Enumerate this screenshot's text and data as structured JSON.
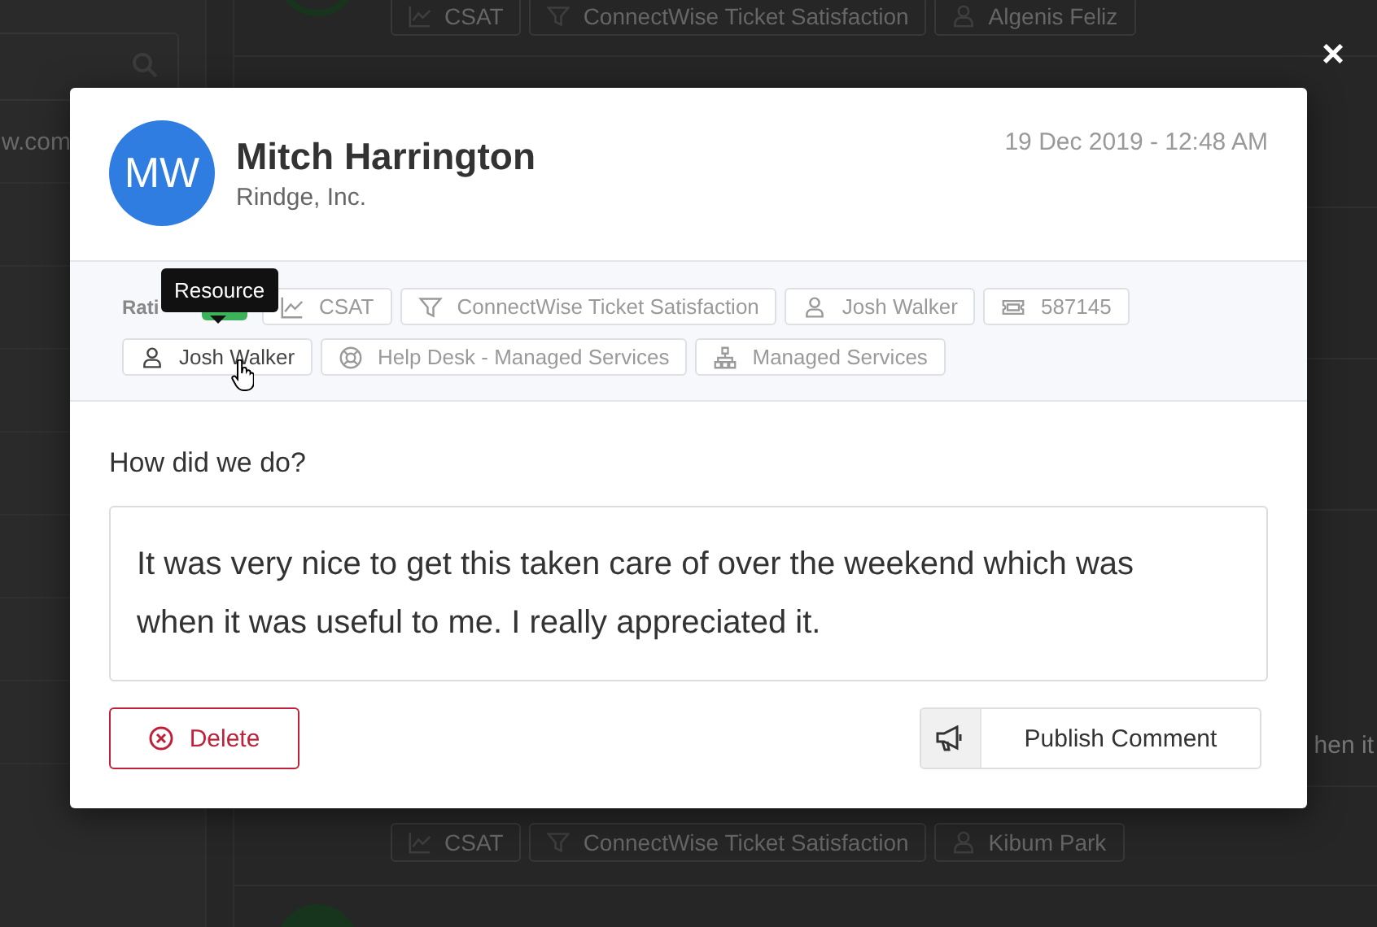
{
  "background": {
    "left_text": "w.com",
    "right_text": "hen it",
    "top_tags": [
      {
        "kind": "chart",
        "label": "CSAT"
      },
      {
        "kind": "filter",
        "label": "ConnectWise Ticket Satisfaction"
      },
      {
        "kind": "person",
        "label": "Algenis Feliz"
      }
    ],
    "bottom_tags": [
      {
        "kind": "chart",
        "label": "CSAT"
      },
      {
        "kind": "filter",
        "label": "ConnectWise Ticket Satisfaction"
      },
      {
        "kind": "person",
        "label": "Kibum Park"
      }
    ]
  },
  "dialog": {
    "close": "×",
    "avatar": "MW",
    "name": "Mitch Harrington",
    "company": "Rindge, Inc.",
    "date": "19 Dec 2019 - 12:48 AM",
    "rating_label": "Rati",
    "tooltip": "Resource",
    "tags": [
      {
        "kind": "chart",
        "label": "CSAT",
        "hovered": false
      },
      {
        "kind": "filter",
        "label": "ConnectWise Ticket Satisfaction",
        "hovered": false
      },
      {
        "kind": "person",
        "label": "Josh Walker",
        "hovered": false
      },
      {
        "kind": "ticket",
        "label": "587145",
        "hovered": false
      },
      {
        "kind": "person",
        "label": "Josh Walker",
        "hovered": true
      },
      {
        "kind": "lifebuoy",
        "label": "Help Desk - Managed Services",
        "hovered": false
      },
      {
        "kind": "org",
        "label": "Managed Services",
        "hovered": false
      }
    ],
    "question": "How did we do?",
    "comment": "It was very nice to get this taken care of over the weekend which was when it was useful to me. I really appreciated it.",
    "delete_button": "Delete",
    "publish_button": "Publish Comment"
  }
}
